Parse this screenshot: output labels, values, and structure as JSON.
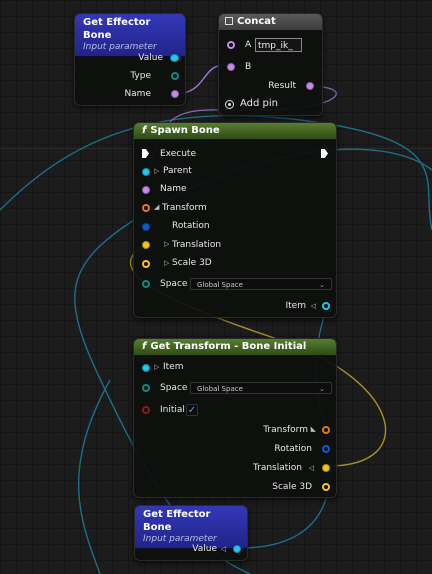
{
  "colors": {
    "name_pin": "#c78ae6",
    "vector_pin": "#f7c519",
    "rotation_pin": "#0a5cd6",
    "transform_pin": "#e8761a",
    "item_pin": "#1ec8f2",
    "type_pin": "#0f8a86",
    "space_pin": "#0f8a86",
    "bool_pin": "#8c1a1a",
    "wire_blue": "#1c6f8a",
    "wire_yellow": "#a79226",
    "wire_purple": "#a67bd8"
  },
  "get_effector_bone_top": {
    "title": "Get Effector Bone",
    "subtitle": "Input parameter",
    "pins": {
      "value": "Value",
      "type": "Type",
      "name": "Name"
    }
  },
  "concat": {
    "title": "Concat",
    "pin_a": "A",
    "a_value": "tmp_ik_",
    "pin_b": "B",
    "result": "Result",
    "add_pin": "Add pin"
  },
  "spawn_bone": {
    "function_icon": "f",
    "title": "Spawn Bone",
    "execute": "Execute",
    "parent": "Parent",
    "name": "Name",
    "transform": "Transform",
    "rotation": "Rotation",
    "translation": "Translation",
    "scale3d": "Scale 3D",
    "space": "Space",
    "space_value": "Global Space",
    "item": "Item"
  },
  "get_transform": {
    "function_icon": "f",
    "title": "Get Transform - Bone Initial",
    "item": "Item",
    "space": "Space",
    "space_value": "Global Space",
    "initial": "Initial",
    "initial_checked": "✓",
    "transform": "Transform",
    "rotation": "Rotation",
    "translation": "Translation",
    "scale3d": "Scale 3D"
  },
  "get_effector_bone_bottom": {
    "title": "Get Effector Bone",
    "subtitle": "Input parameter",
    "value": "Value"
  }
}
